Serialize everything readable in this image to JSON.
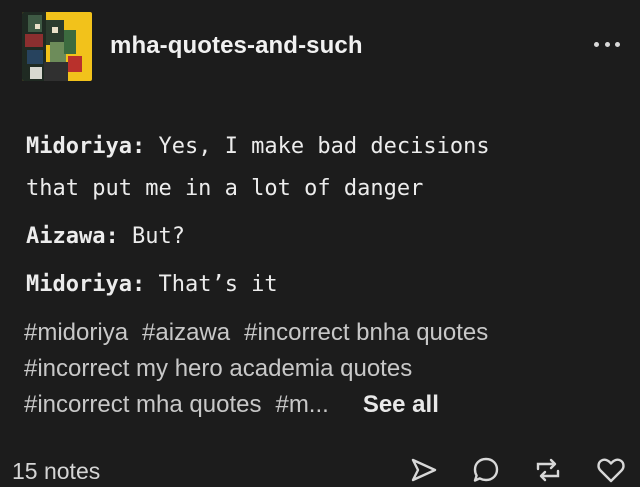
{
  "post": {
    "blog_name": "mha-quotes-and-such",
    "lines": [
      {
        "speaker": "Midoriya:",
        "text": " Yes, I make bad decisions"
      },
      {
        "speaker": "",
        "text": "that put me in a lot of danger"
      },
      {
        "speaker": "Aizawa:",
        "text": " But?"
      },
      {
        "speaker": "Midoriya:",
        "text": " That’s it"
      }
    ],
    "tags": [
      "#midoriya",
      "#aizawa",
      "#incorrect bnha quotes",
      "#incorrect my hero academia quotes",
      "#incorrect mha quotes",
      "#m..."
    ],
    "see_all_label": "See all"
  },
  "footer": {
    "notes_count": "15 notes",
    "actions": [
      "share-icon",
      "reply-icon",
      "reblog-icon",
      "like-icon"
    ]
  },
  "colors": {
    "background": "#1c1c1c",
    "text": "#ececec",
    "tag_text": "#c8c8c8",
    "avatar_bg": "#f2c21b"
  }
}
